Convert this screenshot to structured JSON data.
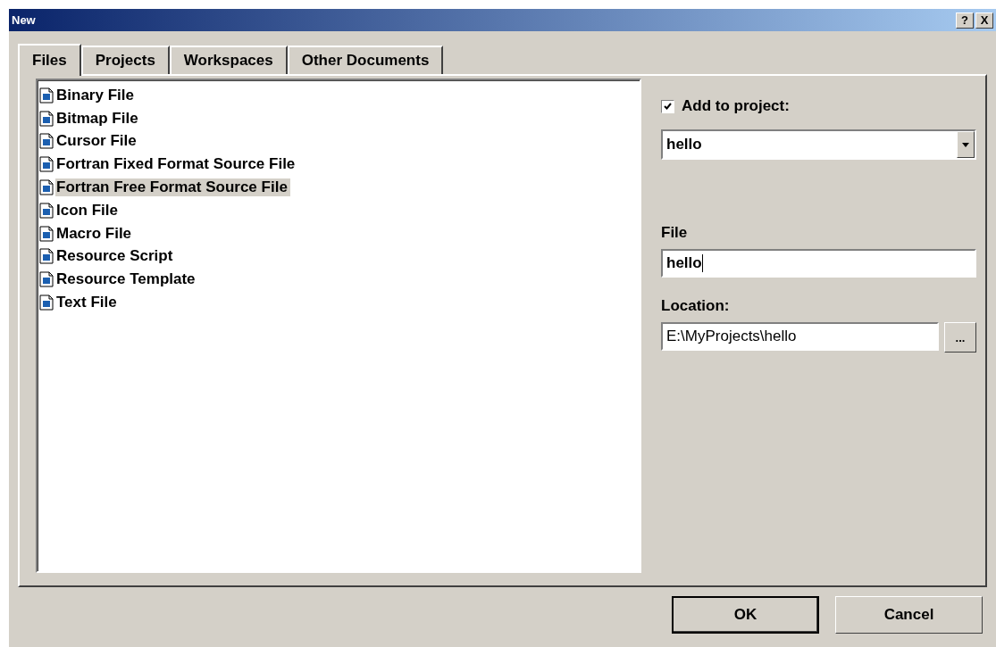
{
  "window": {
    "title": "New",
    "help_button": "?",
    "close_button": "X"
  },
  "tabs": [
    {
      "label": "Files",
      "selected": true
    },
    {
      "label": "Projects",
      "selected": false
    },
    {
      "label": "Workspaces",
      "selected": false
    },
    {
      "label": "Other Documents",
      "selected": false
    }
  ],
  "file_types": [
    {
      "label": "Binary File",
      "selected": false
    },
    {
      "label": "Bitmap File",
      "selected": false
    },
    {
      "label": "Cursor File",
      "selected": false
    },
    {
      "label": "Fortran Fixed Format Source File",
      "selected": false
    },
    {
      "label": "Fortran Free Format Source File",
      "selected": true
    },
    {
      "label": "Icon File",
      "selected": false
    },
    {
      "label": "Macro File",
      "selected": false
    },
    {
      "label": "Resource Script",
      "selected": false
    },
    {
      "label": "Resource Template",
      "selected": false
    },
    {
      "label": "Text File",
      "selected": false
    }
  ],
  "add_to_project": {
    "label": "Add to project:",
    "checked": true,
    "value": "hello"
  },
  "file": {
    "label": "File",
    "value": "hello"
  },
  "location": {
    "label": "Location:",
    "value": "E:\\MyProjects\\hello",
    "browse": "..."
  },
  "buttons": [
    "OK",
    "Cancel"
  ]
}
